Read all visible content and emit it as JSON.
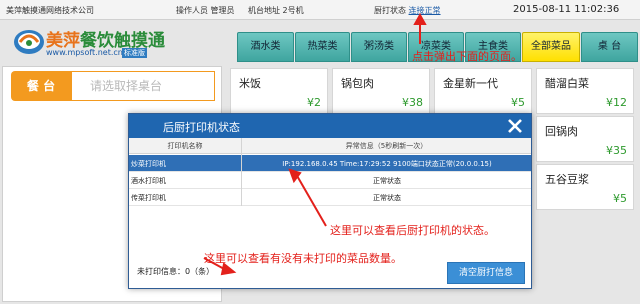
{
  "status_bar": {
    "company": "美萍触摸通网络技术公司",
    "operator": "操作人员  管理员",
    "terminal": "机台地址  2号机",
    "kitchen_label": "厨打状态",
    "kitchen_status": "连接正常",
    "datetime": "2015-08-11  11:02:36"
  },
  "logo": {
    "brand_a": "美萍",
    "brand_b": "餐饮触摸通",
    "url": "www.mpsoft.net.cn",
    "edition": "标准版"
  },
  "category_tabs": [
    {
      "label": "酒水类",
      "active": false
    },
    {
      "label": "热菜类",
      "active": false
    },
    {
      "label": "粥汤类",
      "active": false
    },
    {
      "label": "凉菜类",
      "active": false
    },
    {
      "label": "主食类",
      "active": false
    },
    {
      "label": "全部菜品",
      "active": true
    },
    {
      "label": "桌 台",
      "active": false
    }
  ],
  "table_selector": {
    "tab_label": "餐 台",
    "placeholder": "请选取择桌台"
  },
  "dishes": [
    {
      "name": "米饭",
      "price": "¥2"
    },
    {
      "name": "锅包肉",
      "price": "¥38"
    },
    {
      "name": "金星新一代",
      "price": "¥5"
    },
    {
      "name": "醋溜白菜",
      "price": "¥12"
    },
    {
      "name": "回锅肉",
      "price": "¥35"
    },
    {
      "name": "五谷豆浆",
      "price": "¥5"
    }
  ],
  "dialog": {
    "title": "后厨打印机状态",
    "col_name": "打印机名称",
    "col_status": "异常信息（5秒刷新一次）",
    "printers": [
      {
        "name": "炒菜打印机",
        "status": "IP:192.168.0.45 Time:17:29:52 9100端口状态正常(20.0.0.15)"
      },
      {
        "name": "酒水打印机",
        "status": "正常状态"
      },
      {
        "name": "传菜打印机",
        "status": "正常状态"
      }
    ],
    "unprinted_label": "未打印信息：0（条）",
    "clear_button": "清空厨打信息"
  },
  "annotations": {
    "popup_note": "点击弹出下面的页面。",
    "printer_note": "这里可以查看后厨打印机的状态。",
    "unprinted_note": "这里可以查看有没有未打印的菜品数量。"
  },
  "colors": {
    "accent_red": "#e3201b",
    "dialog_blue": "#1f66b0",
    "tab_teal": "#4fb3ad",
    "tab_active_yellow": "#ffe000",
    "orange": "#f39a1f",
    "price_green": "#2e9a2e"
  }
}
